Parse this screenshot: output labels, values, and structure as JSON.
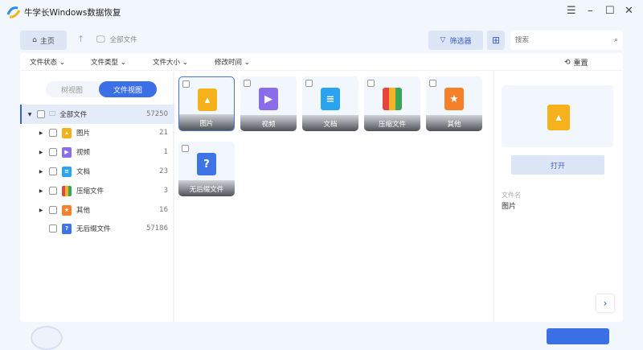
{
  "app": {
    "title": "牛学长Windows数据恢复"
  },
  "nav": {
    "home": "主页",
    "breadcrumb": "全部文件",
    "filter": "筛选器",
    "search_placeholder": "搜索"
  },
  "filters": {
    "items": [
      "文件状态",
      "文件类型",
      "文件大小",
      "修改时间"
    ],
    "reset": "重置"
  },
  "view_toggle": {
    "tree": "树视图",
    "file": "文件视图"
  },
  "tree": [
    {
      "label": "全部文件",
      "count": "57250"
    },
    {
      "label": "图片",
      "count": "21"
    },
    {
      "label": "视频",
      "count": "1"
    },
    {
      "label": "文档",
      "count": "23"
    },
    {
      "label": "压缩文件",
      "count": "3"
    },
    {
      "label": "其他",
      "count": "16"
    },
    {
      "label": "无后缀文件",
      "count": "57186"
    }
  ],
  "cards": [
    "图片",
    "视频",
    "文档",
    "压缩文件",
    "其他",
    "无后缀文件"
  ],
  "preview": {
    "open": "打开",
    "name_label": "文件名",
    "name_value": "图片"
  },
  "colors": {
    "accent": "#3a6fe6",
    "image": "#f5b21c",
    "video": "#8a6de9",
    "doc": "#2aa4f0",
    "zip": "#e6453c",
    "other": "#f5802a",
    "unknown": "#3f74e6"
  }
}
